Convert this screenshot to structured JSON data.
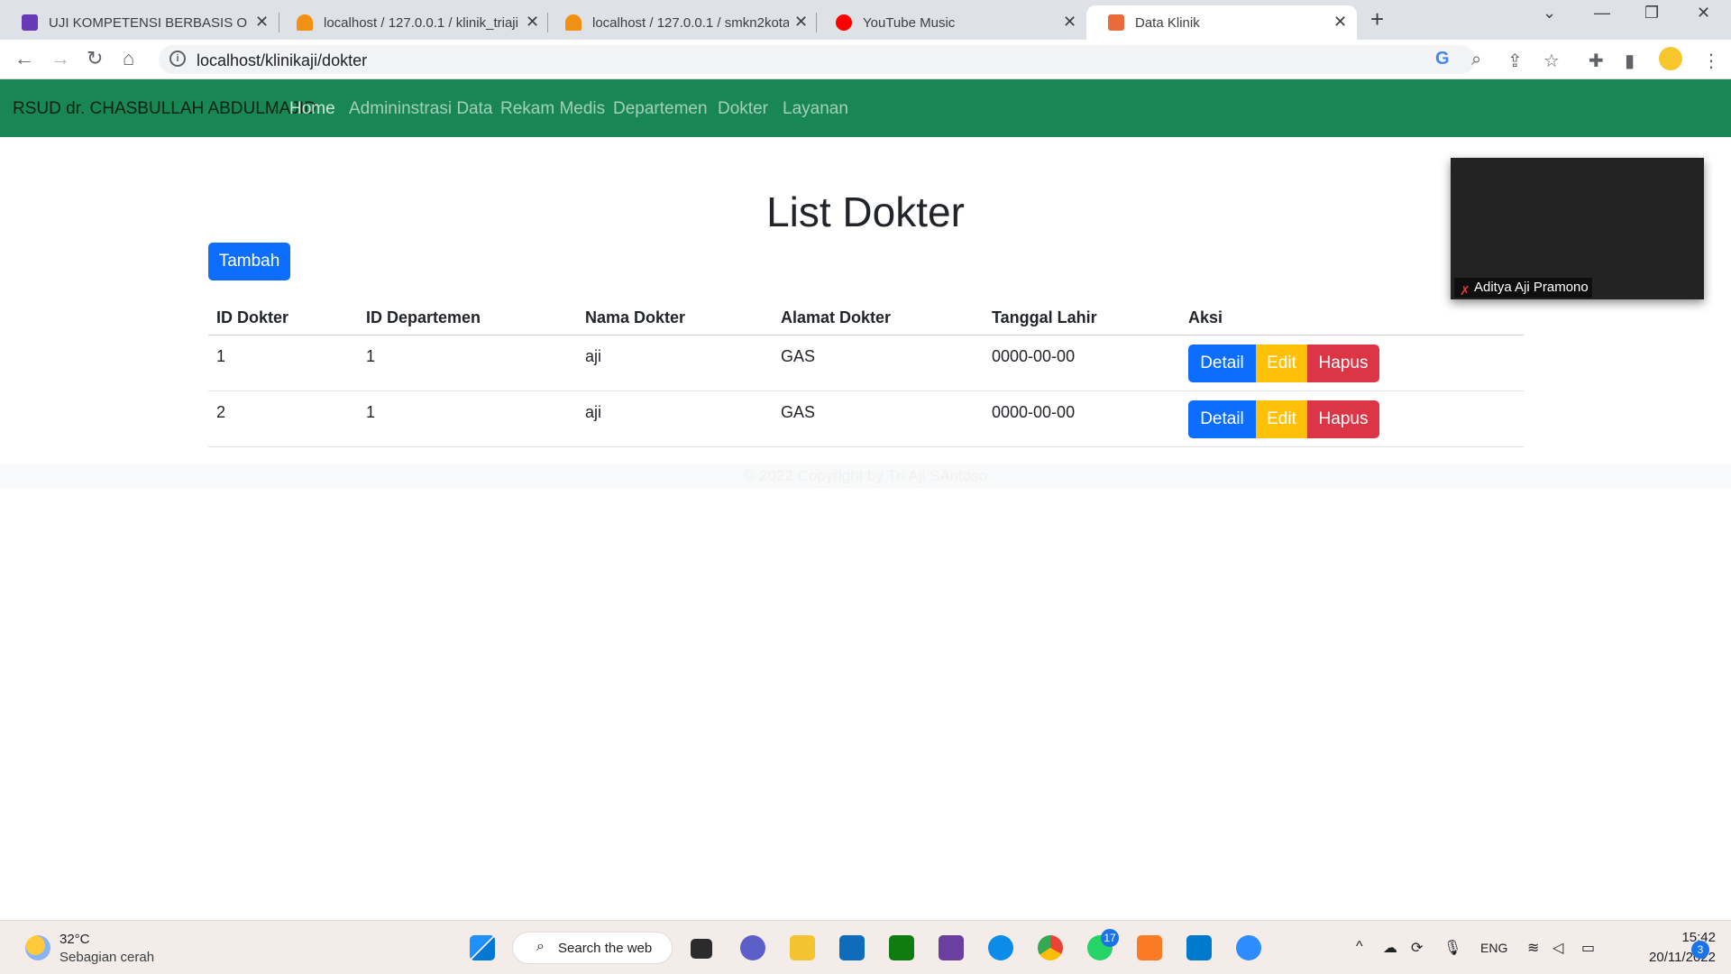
{
  "browser": {
    "tabs": [
      {
        "label": "UJI KOMPETENSI BERBASIS OKUP",
        "color": "#673ab7"
      },
      {
        "label": "localhost / 127.0.0.1 / klinik_triaji",
        "color": "#f29111"
      },
      {
        "label": "localhost / 127.0.0.1 / smkn2kota",
        "color": "#f29111"
      },
      {
        "label": "YouTube Music",
        "color": "#ff0000"
      },
      {
        "label": "Data Klinik",
        "color": "#e86b3a"
      }
    ],
    "url": "localhost/klinikaji/dokter"
  },
  "navbar": {
    "brand": "RSUD dr. CHASBULLAH ABDULMAJID",
    "links": [
      "Home",
      "Admininstrasi Data",
      "Rekam Medis",
      "Departemen",
      "Dokter",
      "Layanan"
    ]
  },
  "main": {
    "title": "List Dokter",
    "add_label": "Tambah",
    "table": {
      "headers": [
        "ID Dokter",
        "ID Departemen",
        "Nama Dokter",
        "Alamat Dokter",
        "Tanggal Lahir",
        "Aksi"
      ],
      "rows": [
        {
          "id": "1",
          "dept": "1",
          "nama": "aji",
          "alamat": "GAS",
          "tgl": "0000-00-00"
        },
        {
          "id": "2",
          "dept": "1",
          "nama": "aji",
          "alamat": "GAS",
          "tgl": "0000-00-00"
        }
      ],
      "actions": {
        "detail": "Detail",
        "edit": "Edit",
        "hapus": "Hapus"
      }
    },
    "footer": "© 2022 Copyright by Tri Aji SAntoso"
  },
  "video": {
    "participant": "Aditya Aji Pramono"
  },
  "taskbar": {
    "temp": "32°C",
    "weather": "Sebagian cerah",
    "search_label": "Search the web",
    "whatsapp_badge": "17",
    "lang": "ENG",
    "time": "15:42",
    "date": "20/11/2022",
    "notif": "3"
  }
}
